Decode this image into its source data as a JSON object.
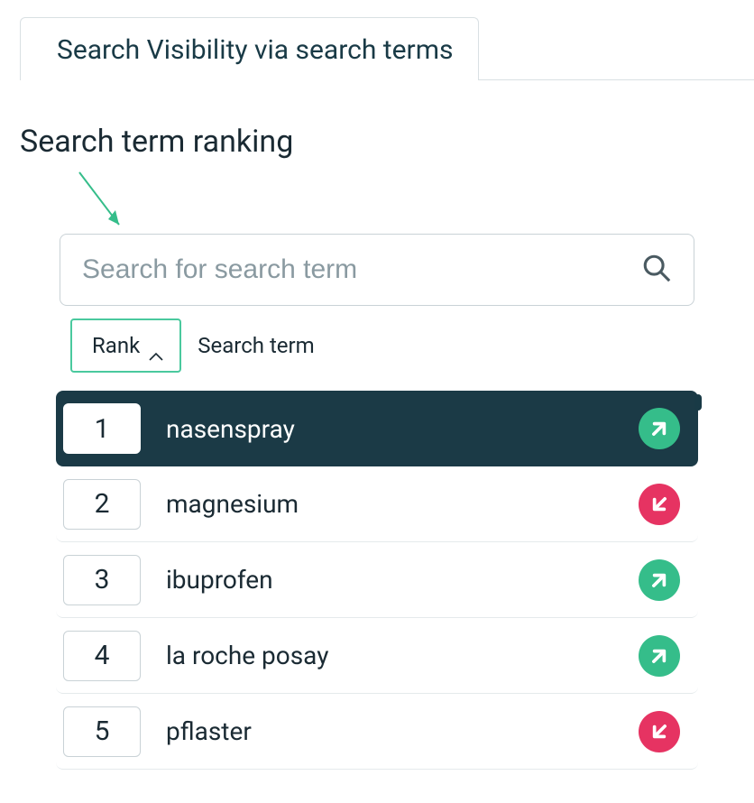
{
  "tabs": {
    "active_label": "Search Visibility via search terms"
  },
  "section": {
    "title": "Search term ranking"
  },
  "search": {
    "placeholder": "Search for search term",
    "value": ""
  },
  "headers": {
    "rank": "Rank",
    "term": "Search term"
  },
  "colors": {
    "accent_teal_dark": "#1b3a46",
    "green": "#35bd8a",
    "red": "#e63362",
    "rank_header_border": "#4ac99e"
  },
  "rows": [
    {
      "rank": "1",
      "term": "nasenspray",
      "trend": "up",
      "selected": true
    },
    {
      "rank": "2",
      "term": "magnesium",
      "trend": "down",
      "selected": false
    },
    {
      "rank": "3",
      "term": "ibuprofen",
      "trend": "up",
      "selected": false
    },
    {
      "rank": "4",
      "term": "la roche posay",
      "trend": "up",
      "selected": false
    },
    {
      "rank": "5",
      "term": "pflaster",
      "trend": "down",
      "selected": false
    }
  ]
}
